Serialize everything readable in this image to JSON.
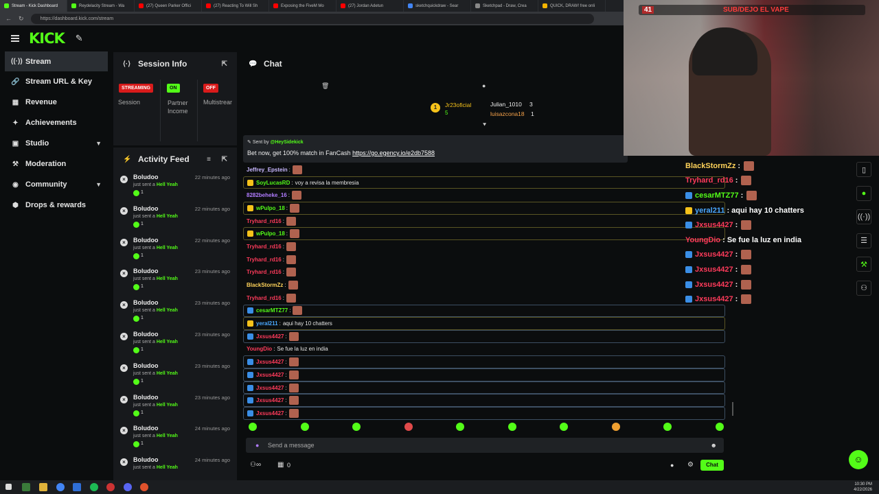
{
  "browser": {
    "tabs": [
      {
        "label": "Stream - Kick Dashboard",
        "color": "#53fc18"
      },
      {
        "label": "Reydelacity Stream - Wa",
        "color": "#53fc18"
      },
      {
        "label": "(27) Queen Parker Offici",
        "color": "#ff0000"
      },
      {
        "label": "(27) Reacting To Will Sh",
        "color": "#ff0000"
      },
      {
        "label": "Exposing the FiveM Mo",
        "color": "#ff0000"
      },
      {
        "label": "(27) Jordan Adetun",
        "color": "#ff0000"
      },
      {
        "label": "sketchquickdraw - Sear",
        "color": "#4285f4"
      },
      {
        "label": "Sketchpad - Draw, Crea",
        "color": "#888888"
      },
      {
        "label": "QUICK, DRAW! free onli",
        "color": "#f4b400"
      }
    ],
    "url": "https://dashboard.kick.com/stream"
  },
  "topbar": {
    "logo": "KICK"
  },
  "sidebar": {
    "items": [
      {
        "label": "Stream",
        "icon": "broadcast-icon",
        "glyph": "((·))"
      },
      {
        "label": "Stream URL & Key",
        "icon": "link-icon",
        "glyph": "🔗"
      },
      {
        "label": "Revenue",
        "icon": "revenue-icon",
        "glyph": "▦"
      },
      {
        "label": "Achievements",
        "icon": "trophy-icon",
        "glyph": "✦"
      },
      {
        "label": "Studio",
        "icon": "studio-icon",
        "glyph": "▣"
      },
      {
        "label": "Moderation",
        "icon": "hammer-icon",
        "glyph": "⚒"
      },
      {
        "label": "Community",
        "icon": "community-icon",
        "glyph": "◉"
      },
      {
        "label": "Drops & rewards",
        "icon": "gift-icon",
        "glyph": "⬢"
      }
    ]
  },
  "session": {
    "title": "Session Info",
    "streaming_badge": "STREAMING",
    "on_badge": "ON",
    "off_badge": "OFF",
    "session_label": "Session",
    "partner_label": "Partner Income",
    "multistream_label": "Multistrear"
  },
  "activity": {
    "title": "Activity Feed",
    "items": [
      {
        "name": "Boludoo",
        "time": "22 minutes ago",
        "desc": "just sent a",
        "item": "Hell Yeah",
        "count": "1"
      },
      {
        "name": "Boludoo",
        "time": "22 minutes ago",
        "desc": "just sent a",
        "item": "Hell Yeah",
        "count": "1"
      },
      {
        "name": "Boludoo",
        "time": "22 minutes ago",
        "desc": "just sent a",
        "item": "Hell Yeah",
        "count": "1"
      },
      {
        "name": "Boludoo",
        "time": "23 minutes ago",
        "desc": "just sent a",
        "item": "Hell Yeah",
        "count": "1"
      },
      {
        "name": "Boludoo",
        "time": "23 minutes ago",
        "desc": "just sent a",
        "item": "Hell Yeah",
        "count": "1"
      },
      {
        "name": "Boludoo",
        "time": "23 minutes ago",
        "desc": "just sent a",
        "item": "Hell Yeah",
        "count": "1"
      },
      {
        "name": "Boludoo",
        "time": "23 minutes ago",
        "desc": "just sent a",
        "item": "Hell Yeah",
        "count": "1"
      },
      {
        "name": "Boludoo",
        "time": "23 minutes ago",
        "desc": "just sent a",
        "item": "Hell Yeah",
        "count": "1"
      },
      {
        "name": "Boludoo",
        "time": "24 minutes ago",
        "desc": "just sent a",
        "item": "Hell Yeah",
        "count": "1"
      },
      {
        "name": "Boludoo",
        "time": "24 minutes ago",
        "desc": "just sent a",
        "item": "Hell Yeah",
        "count": ""
      }
    ]
  },
  "chat": {
    "title": "Chat",
    "leaders": {
      "first": {
        "name": "Jr23oficial",
        "count": "5"
      },
      "second": {
        "name": "Julian_1010",
        "count": "3"
      },
      "third": {
        "name": "luisazcona18",
        "count": "1"
      }
    },
    "pinned": {
      "sent_by": "Sent by",
      "sender": "@HeySidekick",
      "text": "Bet now, get 100% match in FanCash",
      "link": "https://go.egency.io/e2db7588"
    },
    "messages": [
      {
        "user": "Jeffrey_Epstein",
        "color": "#c8b7ff",
        "text": "",
        "emote": true,
        "style": ""
      },
      {
        "user": "SoyLucasRD",
        "color": "#53fc18",
        "text": "voy a revisa la membresia",
        "emote": false,
        "style": "gold"
      },
      {
        "user": "8282beheke_16",
        "color": "#b07cff",
        "text": "",
        "emote": true,
        "style": ""
      },
      {
        "user": "wPulpo_18",
        "color": "#53fc18",
        "text": "",
        "emote": true,
        "style": "gold"
      },
      {
        "user": "Tryhard_rd16",
        "color": "#ff3b5b",
        "text": "",
        "emote": true,
        "style": ""
      },
      {
        "user": "wPulpo_18",
        "color": "#53fc18",
        "text": "",
        "emote": true,
        "style": "gold"
      },
      {
        "user": "Tryhard_rd16",
        "color": "#ff3b5b",
        "text": "",
        "emote": true,
        "style": ""
      },
      {
        "user": "Tryhard_rd16",
        "color": "#ff3b5b",
        "text": "",
        "emote": true,
        "style": ""
      },
      {
        "user": "Tryhard_rd16",
        "color": "#ff3b5b",
        "text": "",
        "emote": true,
        "style": ""
      },
      {
        "user": "BlackStormZz",
        "color": "#ffd35a",
        "text": "",
        "emote": true,
        "style": ""
      },
      {
        "user": "Tryhard_rd16",
        "color": "#ff3b5b",
        "text": "",
        "emote": true,
        "style": ""
      },
      {
        "user": "cesarMTZ77",
        "color": "#53fc18",
        "text": "",
        "emote": true,
        "style": "box"
      },
      {
        "user": "yeral211",
        "color": "#4aa8ff",
        "text": "aqui hay 10 chatters",
        "emote": false,
        "style": "gold"
      },
      {
        "user": "Jxsus4427",
        "color": "#ff3b5b",
        "text": "",
        "emote": true,
        "style": "box"
      },
      {
        "user": "YoungDio",
        "color": "#ff3b5b",
        "text": "Se fue la luz en india",
        "emote": false,
        "style": ""
      },
      {
        "user": "Jxsus4427",
        "color": "#ff3b5b",
        "text": "",
        "emote": true,
        "style": "box"
      },
      {
        "user": "Jxsus4427",
        "color": "#ff3b5b",
        "text": "",
        "emote": true,
        "style": "box"
      },
      {
        "user": "Jxsus4427",
        "color": "#ff3b5b",
        "text": "",
        "emote": true,
        "style": "box"
      },
      {
        "user": "Jxsus4427",
        "color": "#ff3b5b",
        "text": "",
        "emote": true,
        "style": "box"
      },
      {
        "user": "Jxsus4427",
        "color": "#ff3b5b",
        "text": "",
        "emote": true,
        "style": "box"
      }
    ],
    "input_placeholder": "Send a message",
    "viewers": "0",
    "send_label": "Chat"
  },
  "webcam": {
    "counter": "41",
    "title": "SUB/DEJO EL VAPE"
  },
  "overlay": {
    "messages": [
      {
        "user": "BlackStormZz",
        "color": "#ffd35a",
        "text": ":",
        "emote": true
      },
      {
        "user": "Tryhard_rd16",
        "color": "#ff3b5b",
        "text": ":",
        "emote": true
      },
      {
        "user": "cesarMTZ77",
        "color": "#53fc18",
        "text": ":",
        "emote": true
      },
      {
        "user": "yeral211",
        "color": "#4aa8ff",
        "text": ": aqui hay 10 chatters",
        "emote": false
      },
      {
        "user": "Jxsus4427",
        "color": "#ff3b5b",
        "text": ":",
        "emote": true
      },
      {
        "user": "YoungDio",
        "color": "#ff3b5b",
        "text": ": Se fue la luz en india",
        "emote": false
      },
      {
        "user": "Jxsus4427",
        "color": "#ff3b5b",
        "text": ":",
        "emote": true
      },
      {
        "user": "Jxsus4427",
        "color": "#ff3b5b",
        "text": ":",
        "emote": true
      },
      {
        "user": "Jxsus4427",
        "color": "#ff3b5b",
        "text": ":",
        "emote": true
      },
      {
        "user": "Jxsus4427",
        "color": "#ff3b5b",
        "text": ":",
        "emote": true
      }
    ]
  },
  "taskbar": {
    "time": "10:30 PM",
    "date": "4/22/2026"
  },
  "colors": {
    "accent": "#53fc18",
    "bg": "#0b0d0e",
    "panel": "#17191c"
  }
}
